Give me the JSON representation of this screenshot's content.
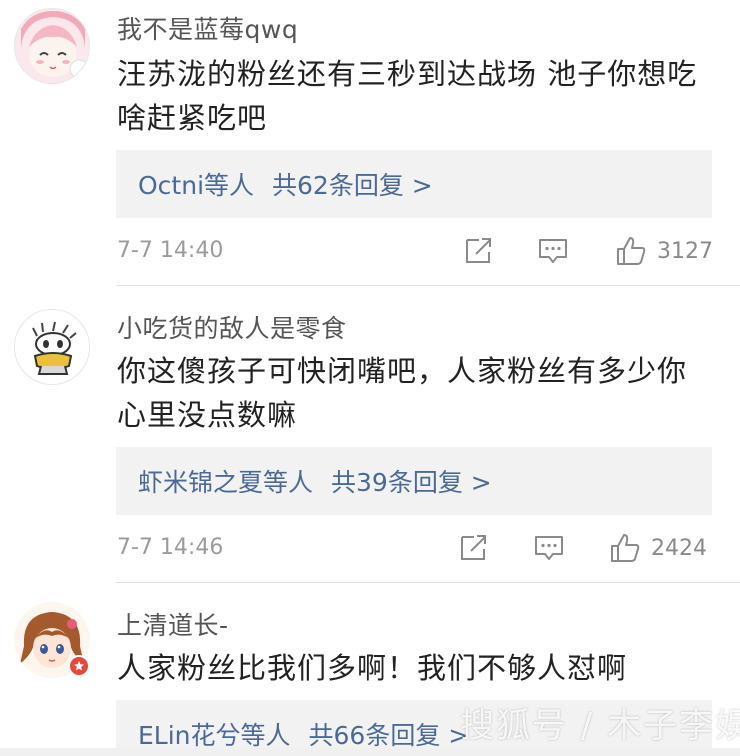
{
  "comments": [
    {
      "username": "我不是蓝莓qwq",
      "content_lines": [
        "汪苏泷的粉丝还有三秒到达战场 池子你想吃",
        "啥赶紧吃吧"
      ],
      "reply_names": "Octni等人",
      "reply_count": "共62条回复 >",
      "time": "7-7 14:40",
      "likes": "3127"
    },
    {
      "username": "小吃货的敌人是零食",
      "content_lines": [
        "你这傻孩子可快闭嘴吧，人家粉丝有多少你",
        "心里没点数嘛"
      ],
      "reply_names": "虾米锦之夏等人",
      "reply_count": "共39条回复 >",
      "time": "7-7 14:46",
      "likes": "2424"
    },
    {
      "username": "上清道长-",
      "content_lines": [
        "人家粉丝比我们多啊！我们不够人怼啊"
      ],
      "reply_names": "ELin花兮等人",
      "reply_count": "共66条回复 >"
    }
  ],
  "watermark": "搜狐号 / 木子李娱",
  "icons": [
    "share-icon",
    "comment-icon",
    "like-icon"
  ],
  "colors": {
    "link": "#4a6a96",
    "meta": "#9b9b9b",
    "reply_bg": "#f2f2f2"
  }
}
